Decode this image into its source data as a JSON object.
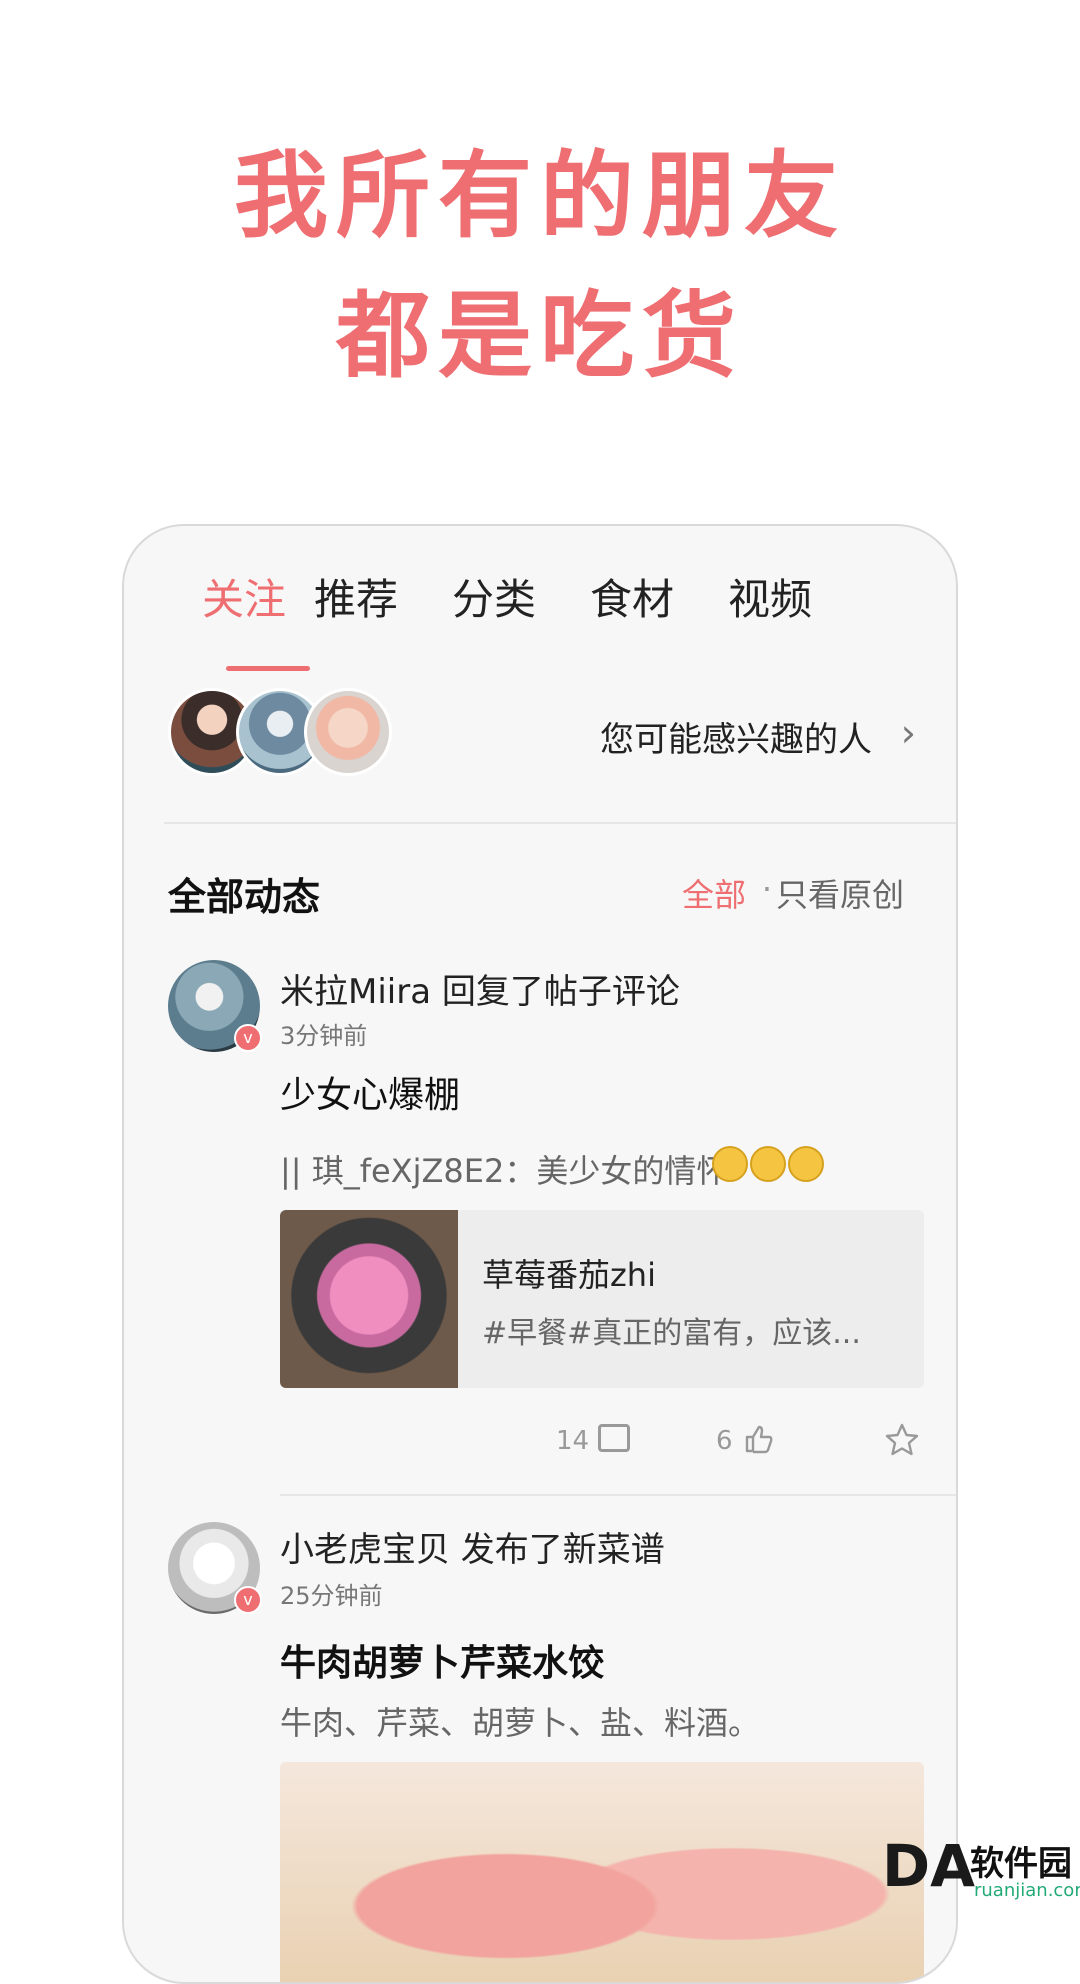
{
  "headline": {
    "line1": "我所有的朋友",
    "line2": "都是吃货"
  },
  "tabs": [
    "关注",
    "推荐",
    "分类",
    "食材",
    "视频"
  ],
  "active_tab": "关注",
  "suggest": {
    "label": "您可能感兴趣的人",
    "chevron": "chevron-right-icon"
  },
  "feed": {
    "section_title": "全部动态",
    "filter_all": "全部",
    "filter_sep": "·",
    "filter_original": "只看原创"
  },
  "post1": {
    "title": "米拉Miira 回复了帖子评论",
    "time": "3分钟前",
    "headline": "少女心爆棚",
    "quote": "|| 琪_feXjZ8E2：美少女的情怀",
    "card_title": "草莓番茄zhi",
    "card_desc": "#早餐#真正的富有，应该...",
    "comments": "14",
    "likes": "6"
  },
  "post2": {
    "title": "小老虎宝贝 发布了新菜谱",
    "time": "25分钟前",
    "headline": "牛肉胡萝卜芹菜水饺",
    "ingredients": "牛肉、芹菜、胡萝卜、盐、料酒。"
  },
  "watermark": {
    "logo": "DA",
    "text": "软件园",
    "sub": "ruanjian.com"
  },
  "colors": {
    "accent": "#ee6e72"
  }
}
